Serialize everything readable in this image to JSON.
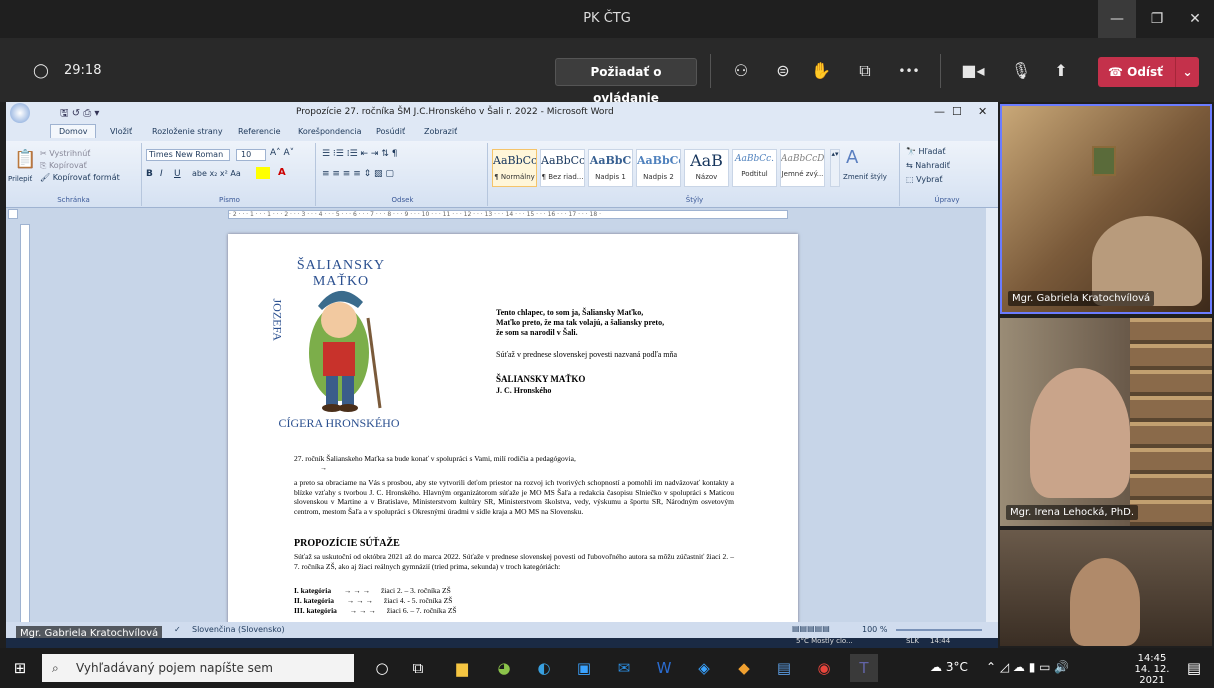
{
  "teams": {
    "window_title": "PK ČTG",
    "timer": "29:18",
    "request_control": "Požiadať o ovládanie",
    "leave_label": "Odísť",
    "more_label": "•••"
  },
  "word": {
    "title": "Propozície 27. ročníka ŠM J.C.Hronského v Šali r. 2022 - Microsoft Word",
    "tabs": [
      "Domov",
      "Vložiť",
      "Rozloženie strany",
      "Referencie",
      "Korešpondencia",
      "Posúdiť",
      "Zobraziť"
    ],
    "clipboard": {
      "paste": "Prilepiť",
      "cut": "Vystrihnúť",
      "copy": "Kopírovať",
      "format": "Kopírovať formát",
      "label": "Schránka"
    },
    "font": {
      "name": "Times New Roman",
      "size": "10",
      "label": "Písmo"
    },
    "paragraph_label": "Odsek",
    "styles": [
      {
        "preview": "AaBbCcI",
        "name": "¶ Normálny"
      },
      {
        "preview": "AaBbCcI",
        "name": "¶ Bez riad..."
      },
      {
        "preview": "AaBbC",
        "name": "Nadpis 1"
      },
      {
        "preview": "AaBbCc",
        "name": "Nadpis 2"
      },
      {
        "preview": "AaB",
        "name": "Názov"
      },
      {
        "preview": "AaBbCc.",
        "name": "Podtitul"
      },
      {
        "preview": "AaBbCcD",
        "name": "Jemné zvý..."
      }
    ],
    "styles_label": "Štýly",
    "change_styles": "Zmeniť štýly",
    "editing": {
      "find": "Hľadať",
      "replace": "Nahradiť",
      "select": "Vybrať",
      "label": "Úpravy"
    },
    "ruler_text": "· 2 · · · 1 · · · 1 · · · 2 · · · 3 · · · 4 · · · 5 · · · 6 · · · 7 · · · 8 · · · 9 · · · 10 · · · 11 · · · 12 · · · 13 · · · 14 · · · 15 · · · 16 · · · 17 · · · 18 ·",
    "status_language": "Slovenčina (Slovensko)",
    "zoom": "100 %"
  },
  "doc": {
    "logo_top": "ŠALIANSKY MAŤKO",
    "logo_left": "JOZEFA",
    "logo_bottom": "CÍGERA HRONSKÉHO",
    "intro1": "Tento chlapec, to som ja, Šaliansky Maťko,",
    "intro2": "Maťko preto, že ma tak volajú, a šaliansky preto,",
    "intro3": "že som sa narodil v Šali.",
    "contest": "Súťaž v prednese slovenskej povesti nazvaná podľa mňa",
    "heading1": "ŠALIANSKY MAŤKO",
    "heading2": "J. C. Hronského",
    "p1": "27. ročník Šalianskeho Maťka sa bude konať v spolupráci s Vami, milí rodičia a pedagógovia,",
    "arrow": "→",
    "p2": "a preto sa obraciame na Vás s prosbou, aby ste vytvorili deťom priestor na rozvoj ich tvorivých schopností a pomohli im nadväzovať kontakty a blízke vzťahy s tvorbou J. C. Hronského. Hlavným organizátorom súťaže je MO MS Šaľa a redakcia časopisu Slniečko v spolupráci s Maticou slovenskou v Martine a v Bratislave, Ministerstvom kultúry SR, Ministerstvom školstva, vedy, výskumu a športu SR, Národným osvetovým centrom, mestom Šaľa a v spolupráci s Okresnými úradmi v sídle kraja a MO MS na Slovensku.",
    "prop_title": "PROPOZÍCIE SÚŤAŽE",
    "p3": "Súťaž sa uskutoční od októbra 2021 až do marca 2022. Súťaže v prednese slovenskej povesti od ľubovoľného autora sa môžu zúčastniť žiaci 2. – 7. ročníka ZŠ, ako aj žiaci reálnych gymnázií (tried prima, sekunda) v troch kategóriách:",
    "categories": [
      {
        "name": "I. kategória",
        "arrows": "→ → →",
        "desc": "žiaci 2. – 3. ročníka ZŠ"
      },
      {
        "name": "II. kategória",
        "arrows": "→ → →",
        "desc": "žiaci 4. - 5. ročníka ZŠ"
      },
      {
        "name": "III. kategória",
        "arrows": "→ → →",
        "desc": "žiaci 6. – 7. ročníka ZŠ"
      }
    ]
  },
  "participants": [
    {
      "name": "Mgr. Gabriela Kratochvílová"
    },
    {
      "name": "Mgr. Irena Lehocká, PhD."
    },
    {
      "name": ""
    }
  ],
  "screen_share_label": "Mgr. Gabriela Kratochvílová",
  "taskbar": {
    "search_placeholder": "Vyhľadávaný pojem napíšte sem",
    "weather_inner": "5°C  Mostly clo...",
    "lang_inner": "SLK",
    "time_inner": "14:44",
    "temp": "3°C",
    "time": "14:45",
    "date": "14. 12. 2021",
    "notif": "1"
  }
}
